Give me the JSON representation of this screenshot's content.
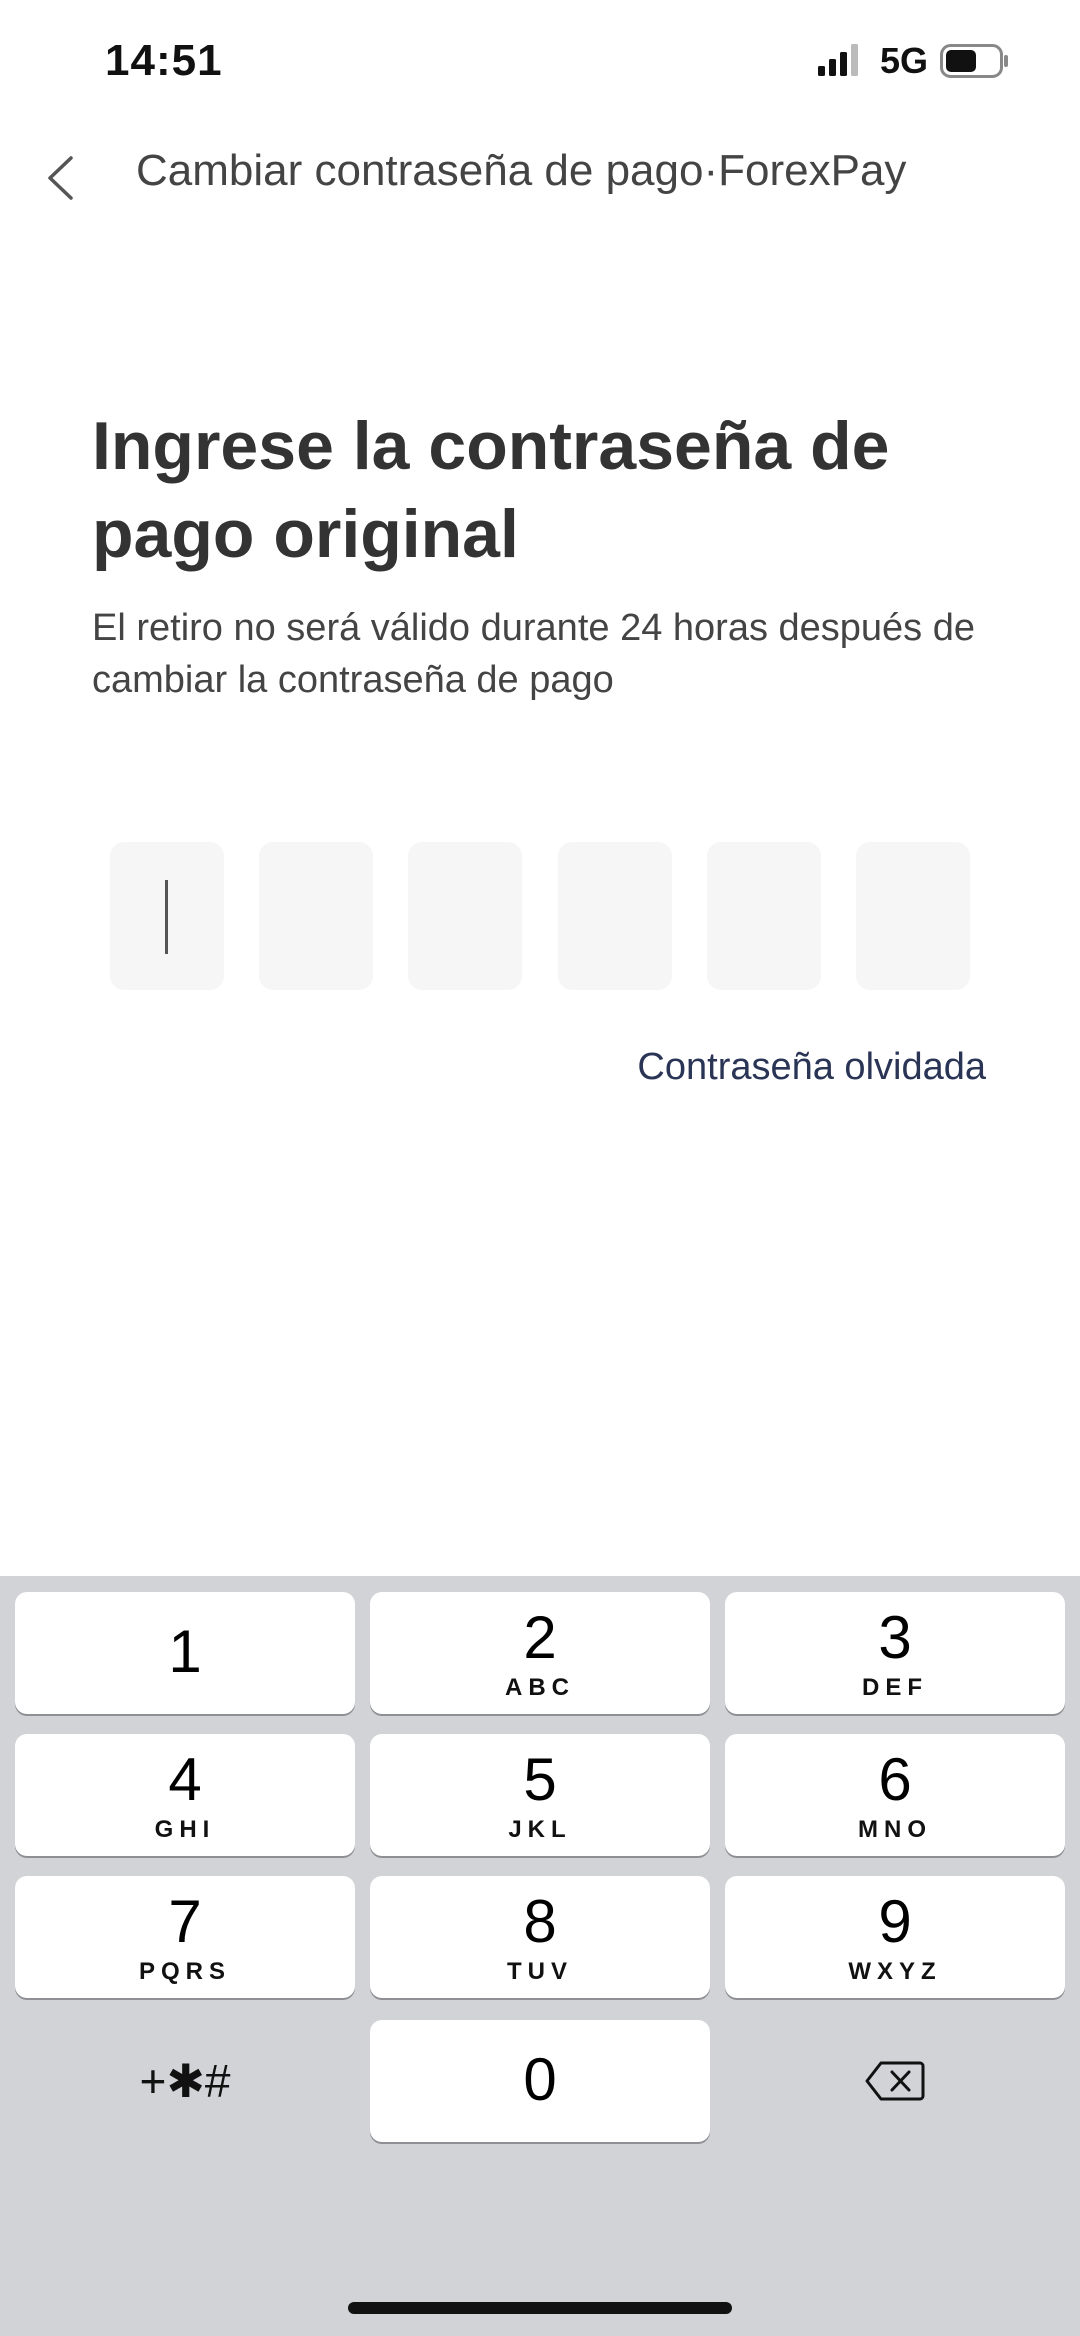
{
  "status_bar": {
    "time": "14:51",
    "network": "5G"
  },
  "nav": {
    "title": "Cambiar contraseña de pago·ForexPay"
  },
  "main": {
    "heading": "Ingrese la contraseña de pago original",
    "subtext": "El retiro no será válido durante 24 horas después de cambiar la contraseña de pago",
    "forgot_link": "Contraseña olvidada"
  },
  "keypad": {
    "keys": [
      {
        "digit": "1",
        "letters": ""
      },
      {
        "digit": "2",
        "letters": "ABC"
      },
      {
        "digit": "3",
        "letters": "DEF"
      },
      {
        "digit": "4",
        "letters": "GHI"
      },
      {
        "digit": "5",
        "letters": "JKL"
      },
      {
        "digit": "6",
        "letters": "MNO"
      },
      {
        "digit": "7",
        "letters": "PQRS"
      },
      {
        "digit": "8",
        "letters": "TUV"
      },
      {
        "digit": "9",
        "letters": "WXYZ"
      },
      {
        "digit": "0",
        "letters": ""
      }
    ],
    "symbols": "+✱#"
  },
  "colors": {
    "link": "#2a3556",
    "keypad_bg": "#d2d3d7",
    "pin_box_bg": "#f6f6f6"
  }
}
